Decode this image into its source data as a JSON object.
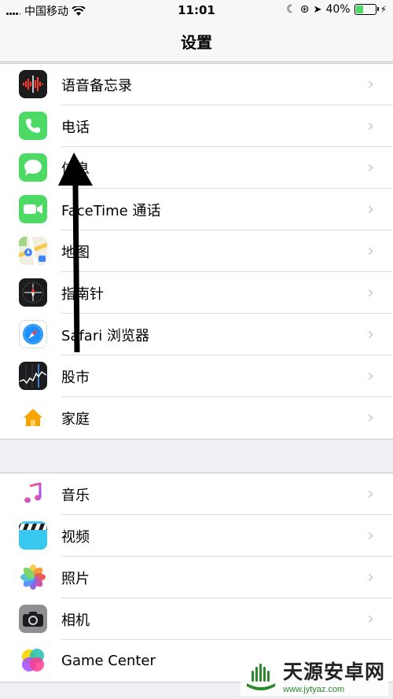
{
  "status_bar": {
    "carrier": "中国移动",
    "time": "11:01",
    "battery": "40%",
    "battery_level": 0.4
  },
  "nav": {
    "title": "设置"
  },
  "groups": [
    {
      "items": [
        {
          "label": "语音备忘录",
          "icon": "voice-memos-icon"
        },
        {
          "label": "电话",
          "icon": "phone-icon"
        },
        {
          "label": "信息",
          "icon": "messages-icon"
        },
        {
          "label": "FaceTime 通话",
          "icon": "facetime-icon"
        },
        {
          "label": "地图",
          "icon": "maps-icon"
        },
        {
          "label": "指南针",
          "icon": "compass-icon"
        },
        {
          "label": "Safari 浏览器",
          "icon": "safari-icon"
        },
        {
          "label": "股市",
          "icon": "stocks-icon"
        },
        {
          "label": "家庭",
          "icon": "home-icon"
        }
      ]
    },
    {
      "items": [
        {
          "label": "音乐",
          "icon": "music-icon"
        },
        {
          "label": "视频",
          "icon": "videos-icon"
        },
        {
          "label": "照片",
          "icon": "photos-icon"
        },
        {
          "label": "相机",
          "icon": "camera-icon"
        },
        {
          "label": "Game Center",
          "icon": "game-center-icon"
        }
      ]
    }
  ],
  "watermark": {
    "name": "天源安卓网",
    "url": "www.jytyaz.com"
  },
  "colors": {
    "phone": "#4cd964",
    "messages": "#4cd964",
    "facetime": "#4cd964",
    "home": "#ffffff",
    "chevron": "#c7c7cc"
  }
}
